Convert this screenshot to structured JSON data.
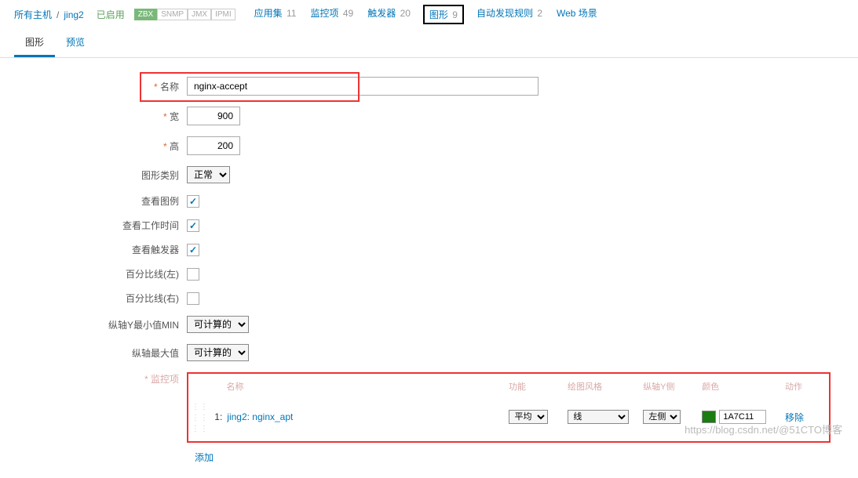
{
  "breadcrumb": {
    "all_hosts": "所有主机",
    "host": "jing2",
    "status": "已启用",
    "badges": [
      "ZBX",
      "SNMP",
      "JMX",
      "IPMI"
    ]
  },
  "nav": {
    "apps": {
      "label": "应用集",
      "count": "11"
    },
    "items": {
      "label": "监控项",
      "count": "49"
    },
    "triggers": {
      "label": "触发器",
      "count": "20"
    },
    "graphs": {
      "label": "图形",
      "count": "9"
    },
    "discovery": {
      "label": "自动发现规则",
      "count": "2"
    },
    "web": {
      "label": "Web 场景"
    }
  },
  "tabs": {
    "graph": "图形",
    "preview": "预览"
  },
  "form": {
    "name_label": "名称",
    "name_value": "nginx-accept",
    "width_label": "宽",
    "width_value": "900",
    "height_label": "高",
    "height_value": "200",
    "type_label": "图形类别",
    "type_value": "正常",
    "legend_label": "查看图例",
    "worktime_label": "查看工作时间",
    "triggers_label": "查看触发器",
    "pct_left_label": "百分比线(左)",
    "pct_right_label": "百分比线(右)",
    "ymin_label": "纵轴Y最小值MIN",
    "ymin_value": "可计算的",
    "ymax_label": "纵轴最大值",
    "ymax_value": "可计算的"
  },
  "items_section": {
    "label": "监控项",
    "headers": {
      "name": "名称",
      "func": "功能",
      "draw": "绘图风格",
      "yaxis": "纵轴Y侧",
      "color": "颜色",
      "action": "动作"
    },
    "rows": [
      {
        "idx": "1:",
        "name": "jing2: nginx_apt",
        "func": "平均",
        "draw": "线",
        "yaxis": "左侧",
        "color": "1A7C11",
        "remove": "移除"
      }
    ],
    "add": "添加"
  },
  "watermark": "https://blog.csdn.net/@51CTO博客"
}
